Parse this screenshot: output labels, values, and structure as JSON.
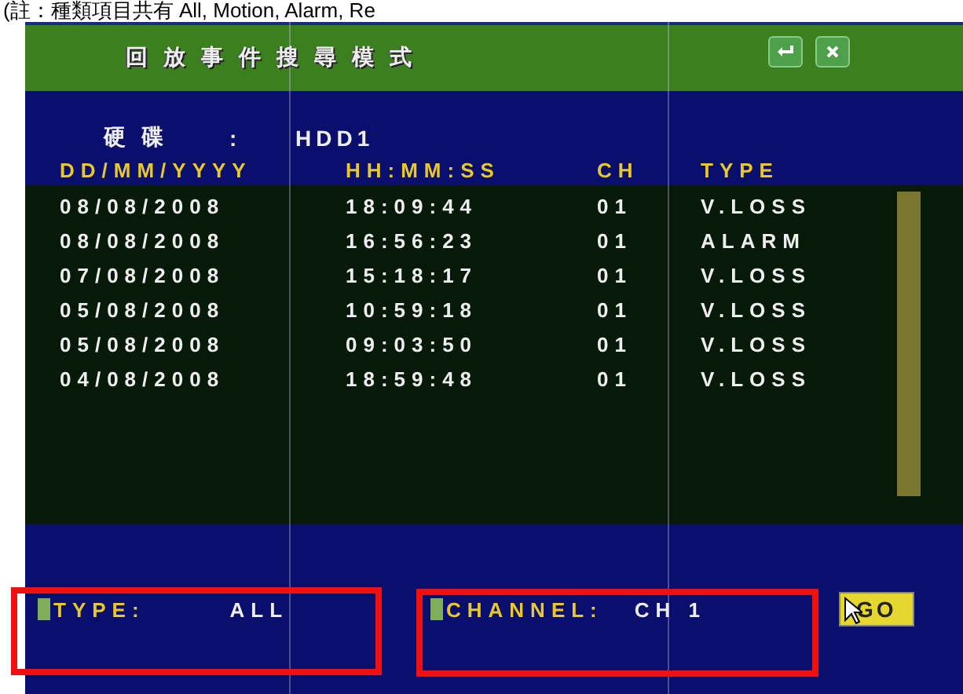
{
  "caption": "(註：種類項目共有 All, Motion, Alarm, Re",
  "window": {
    "title": "回放事件搜尋模式",
    "buttons": [
      {
        "kind": "enter"
      },
      {
        "kind": "close"
      }
    ]
  },
  "disk": {
    "label": "硬碟",
    "separator": ":",
    "value": "HDD1"
  },
  "table": {
    "columns": [
      "DD/MM/YYYY",
      "HH:MM:SS",
      "CH",
      "TYPE"
    ],
    "rows": [
      {
        "date": "08/08/2008",
        "time": "18:09:44",
        "ch": "01",
        "type": "V.LOSS"
      },
      {
        "date": "08/08/2008",
        "time": "16:56:23",
        "ch": "01",
        "type": "ALARM"
      },
      {
        "date": "07/08/2008",
        "time": "15:18:17",
        "ch": "01",
        "type": "V.LOSS"
      },
      {
        "date": "05/08/2008",
        "time": "10:59:18",
        "ch": "01",
        "type": "V.LOSS"
      },
      {
        "date": "05/08/2008",
        "time": "09:03:50",
        "ch": "01",
        "type": "V.LOSS"
      },
      {
        "date": "04/08/2008",
        "time": "18:59:48",
        "ch": "01",
        "type": "V.LOSS"
      }
    ]
  },
  "filters": [
    {
      "label": "TYPE:",
      "value": "ALL",
      "highlighted": true
    },
    {
      "label": "CHANNEL:",
      "value": "CH 1",
      "highlighted": true
    }
  ],
  "go_button": "GO"
}
